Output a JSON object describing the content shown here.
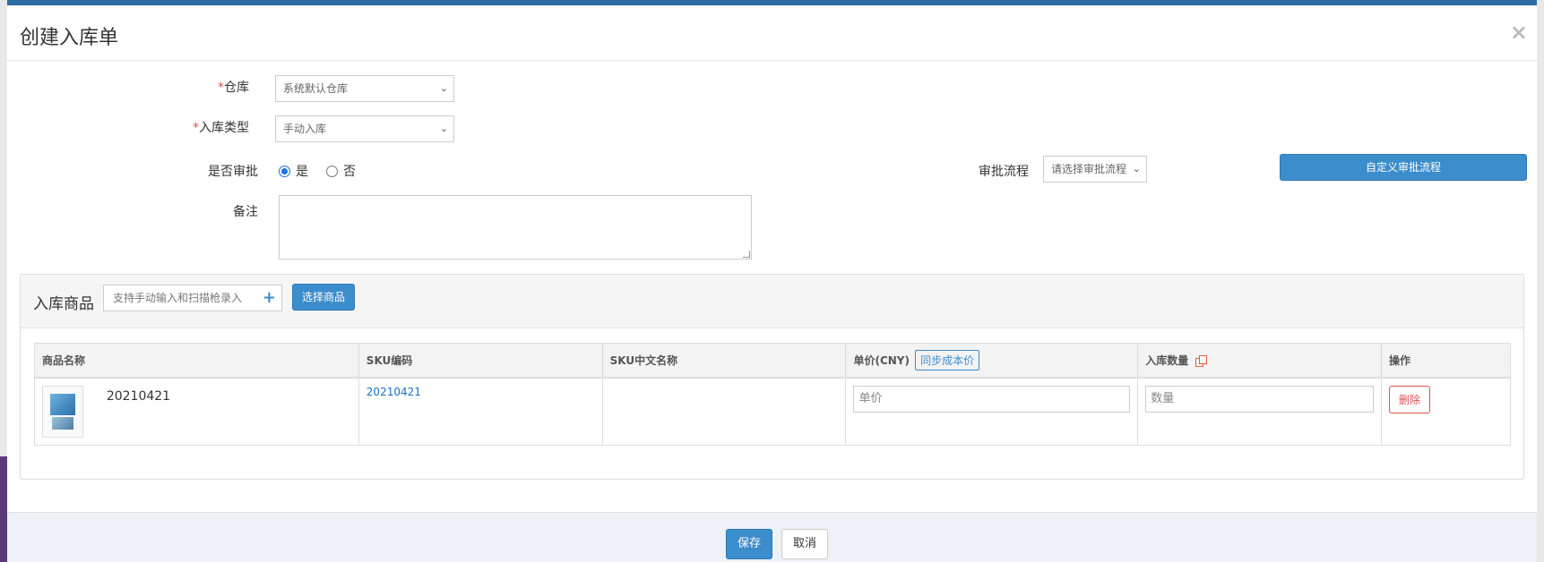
{
  "modal": {
    "title": "创建入库单",
    "close_icon": "×"
  },
  "form": {
    "warehouse": {
      "required_mark": "*",
      "label": "仓库",
      "value": "系统默认仓库"
    },
    "inbound_type": {
      "required_mark": "*",
      "label": "入库类型",
      "value": "手动入库"
    },
    "approval": {
      "label": "是否审批",
      "option_yes": "是",
      "option_no": "否",
      "selected": "是"
    },
    "approval_flow": {
      "label": "审批流程",
      "placeholder": "请选择审批流程"
    },
    "custom_flow_button": "自定义审批流程",
    "remark": {
      "label": "备注",
      "value": ""
    }
  },
  "products_panel": {
    "title": "入库商品",
    "scan_placeholder": "支持手动输入和扫描枪录入",
    "plus_icon": "plus-icon",
    "select_button": "选择商品",
    "columns": [
      "商品名称",
      "SKU编码",
      "SKU中文名称",
      "单价(CNY)",
      "入库数量",
      "操作"
    ],
    "sync_cost_button": "同步成本价",
    "rows": [
      {
        "name": "20210421",
        "sku_code": "20210421",
        "sku_cn_name": "",
        "price_placeholder": "单价",
        "qty_placeholder": "数量",
        "delete_label": "删除"
      }
    ]
  },
  "footer": {
    "save_label": "保存",
    "cancel_label": "取消"
  },
  "colors": {
    "primary": "#3c8dcc",
    "danger": "#d9534f",
    "link": "#1a6fbf"
  }
}
